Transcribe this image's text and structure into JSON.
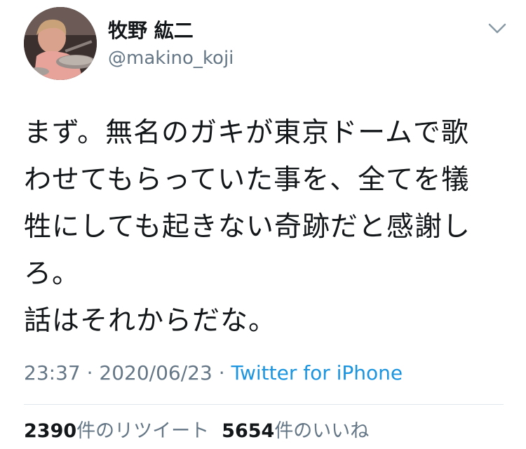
{
  "user": {
    "display_name": "牧野 紘二",
    "handle": "@makino_koji",
    "avatar_icon": "profile-photo-drummer"
  },
  "menu": {
    "icon": "chevron-down-icon"
  },
  "tweet": {
    "text": "まず。無名のガキが東京ドームで歌\nわせてもらっていた事を、全てを犠\n牲にしても起きない奇跡だと感謝し\nろ。\n話はそれからだな。",
    "time": "23:37",
    "separator1": " · ",
    "date": "2020/06/23",
    "separator2": " · ",
    "source": "Twitter for iPhone"
  },
  "stats": {
    "retweet_count": "2390",
    "retweet_label": "件のリツイート",
    "like_count": "5654",
    "like_label": "件のいいね"
  },
  "colors": {
    "text": "#14171a",
    "secondary": "#657786",
    "link": "#1b95e0",
    "divider": "#e1e8ed"
  }
}
